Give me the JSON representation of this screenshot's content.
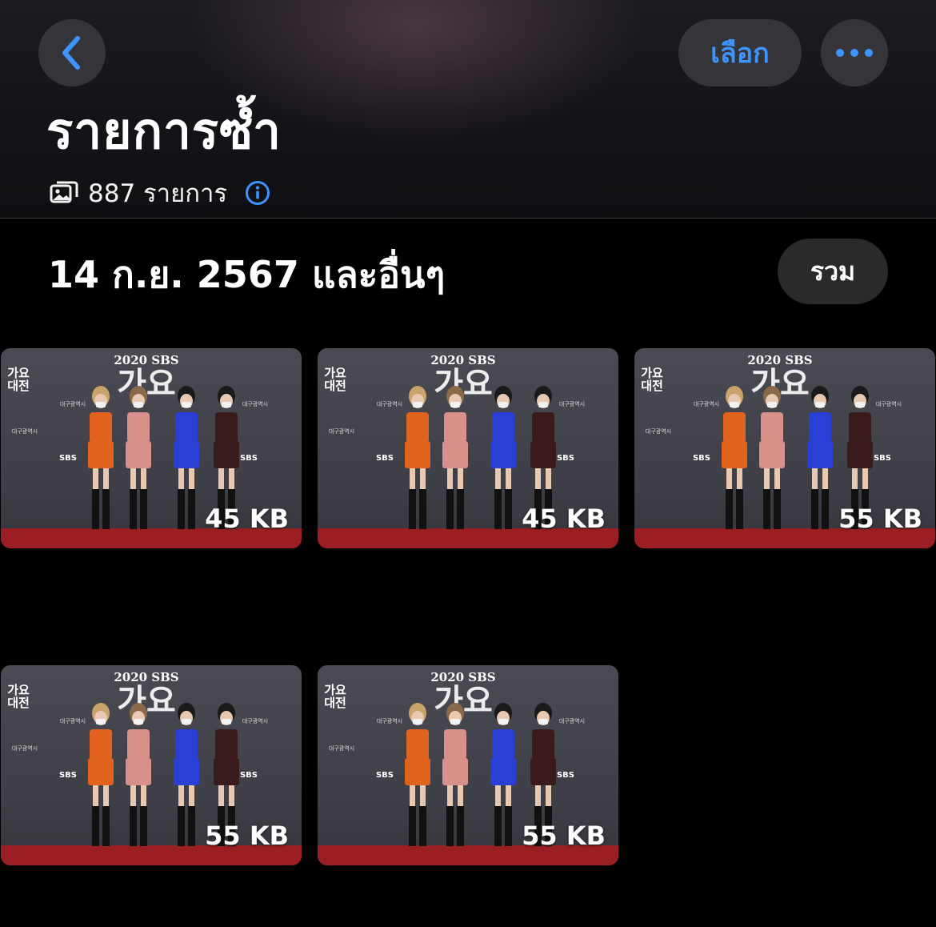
{
  "header": {
    "title": "รายการซ้ำ",
    "select_label": "เลือก",
    "item_count": "887 รายการ",
    "icons": {
      "back": "chevron-left-icon",
      "more": "ellipsis-icon",
      "photos": "photos-stack-icon",
      "info": "info-icon"
    },
    "accent_color": "#3d94ff"
  },
  "section": {
    "date_label": "14 ก.ย. 2567 และอื่นๆ",
    "merge_label": "รวม"
  },
  "thumbnails": [
    {
      "size": "45 KB"
    },
    {
      "size": "45 KB"
    },
    {
      "size": "55 KB"
    },
    {
      "size": "55 KB"
    },
    {
      "size": "55 KB"
    }
  ],
  "thumbnail_text": {
    "event": "2020 SBS",
    "logo_top": "가요",
    "logo_bottom": "대전",
    "sponsor": "SBS",
    "city": "대구광역시"
  }
}
